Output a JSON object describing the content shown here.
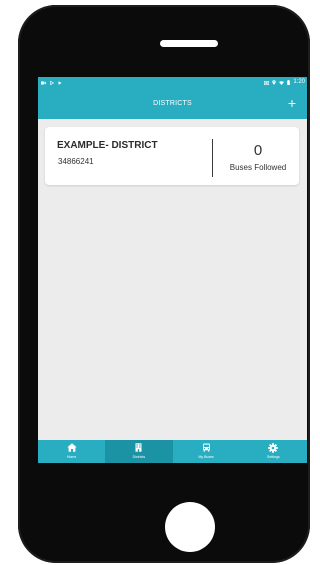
{
  "status_bar": {
    "time": "1:20"
  },
  "app_bar": {
    "title": "DISTRICTS",
    "add_label": "+"
  },
  "district_card": {
    "name": "EXAMPLE- DISTRICT",
    "code": "34866241",
    "buses_followed_count": "0",
    "buses_followed_label": "Buses Followed"
  },
  "bottom_nav": {
    "items": [
      {
        "label": "Home",
        "icon": "home-icon",
        "active": false
      },
      {
        "label": "Districts",
        "icon": "building-icon",
        "active": true
      },
      {
        "label": "My Buses",
        "icon": "bus-icon",
        "active": false
      },
      {
        "label": "Settings",
        "icon": "gear-icon",
        "active": false
      }
    ]
  },
  "colors": {
    "accent": "#29aec1",
    "accent_active": "#1b93a4",
    "background": "#ececec"
  }
}
